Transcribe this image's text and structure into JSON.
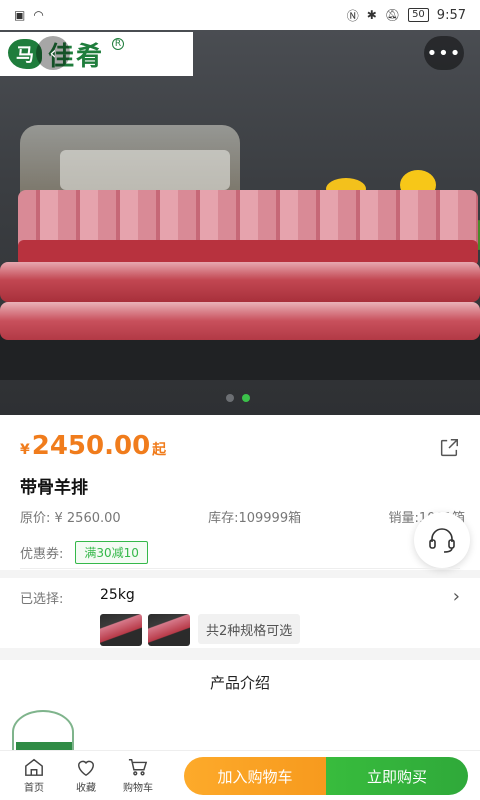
{
  "status_bar": {
    "time": "9:57",
    "battery": "50"
  },
  "header": {
    "logo_text": "佳肴",
    "logo_mark": "马",
    "logo_registered": "R",
    "more_label": "•••",
    "back_label": "‹"
  },
  "hero": {
    "slide_count": 2,
    "active_slide": 2
  },
  "product": {
    "currency": "¥",
    "price": "2450.00",
    "price_suffix": "起",
    "title": "带骨羊排",
    "original_price": "原价: ¥ 2560.00",
    "stock": "库存:109999箱",
    "sales": "销量:1001箱",
    "coupon_label": "优惠券:",
    "coupon": "满30减10"
  },
  "spec": {
    "label": "已选择:",
    "value": "25kg",
    "arrow": "›",
    "count_text": "共2种规格可选"
  },
  "intro": {
    "title": "产品介绍"
  },
  "bottom_bar": {
    "tabs": [
      {
        "label": "首页",
        "icon": "home-icon"
      },
      {
        "label": "收藏",
        "icon": "heart-icon"
      },
      {
        "label": "购物车",
        "icon": "cart-icon"
      }
    ],
    "add_to_cart": "加入购物车",
    "buy_now": "立即购买"
  },
  "colors": {
    "price": "#f07c1c",
    "accent_green": "#35b84a",
    "cart_orange": "#fdaa2a"
  }
}
